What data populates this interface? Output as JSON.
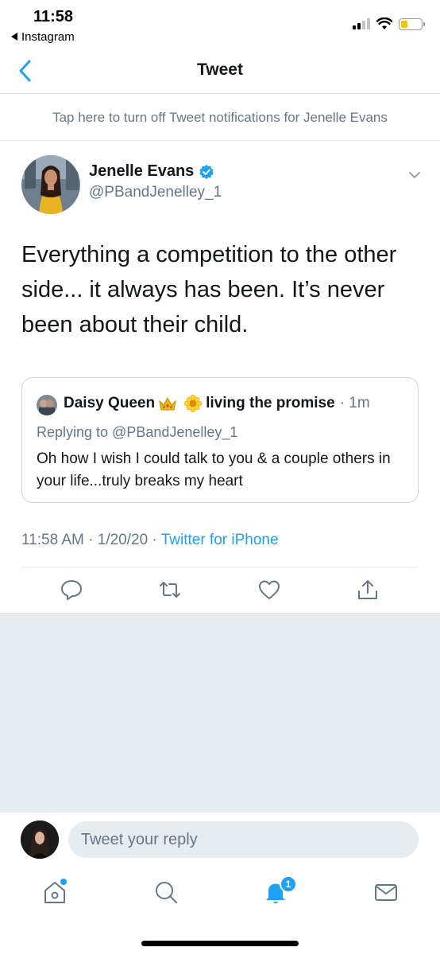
{
  "status_bar": {
    "time": "11:58",
    "back_app": "Instagram",
    "battery_color": "#f7c600"
  },
  "nav": {
    "title": "Tweet",
    "back_icon": "chevron-left-icon"
  },
  "notification_banner": "Tap here to turn off Tweet notifications for Jenelle Evans",
  "tweet": {
    "author_name": "Jenelle Evans",
    "author_handle": "@PBandJenelley_1",
    "verified": true,
    "text": "Everything a competition to the other side... it always has been. It’s never been about their child.",
    "timestamp": "11:58 AM · 1/20/20",
    "separator": " · ",
    "source": "Twitter for iPhone"
  },
  "quoted_tweet": {
    "name_part1": "Daisy Queen",
    "name_part2": "living the promise",
    "emojis": [
      "crown-icon",
      "sunflower-icon"
    ],
    "time": "· 1m",
    "replying_to": "Replying to @PBandJenelley_1",
    "text": "Oh how I wish I could talk to you & a couple others in your life...truly breaks my heart"
  },
  "actions": [
    "reply-icon",
    "retweet-icon",
    "like-icon",
    "share-icon"
  ],
  "reply_bar": {
    "placeholder": "Tweet your reply"
  },
  "tab_bar": {
    "items": [
      "home-icon",
      "search-icon",
      "notifications-icon",
      "messages-icon"
    ],
    "notification_count": "1"
  },
  "colors": {
    "accent": "#1da1f2",
    "secondary_text": "#657786",
    "background_gray": "#e6ecf0"
  }
}
